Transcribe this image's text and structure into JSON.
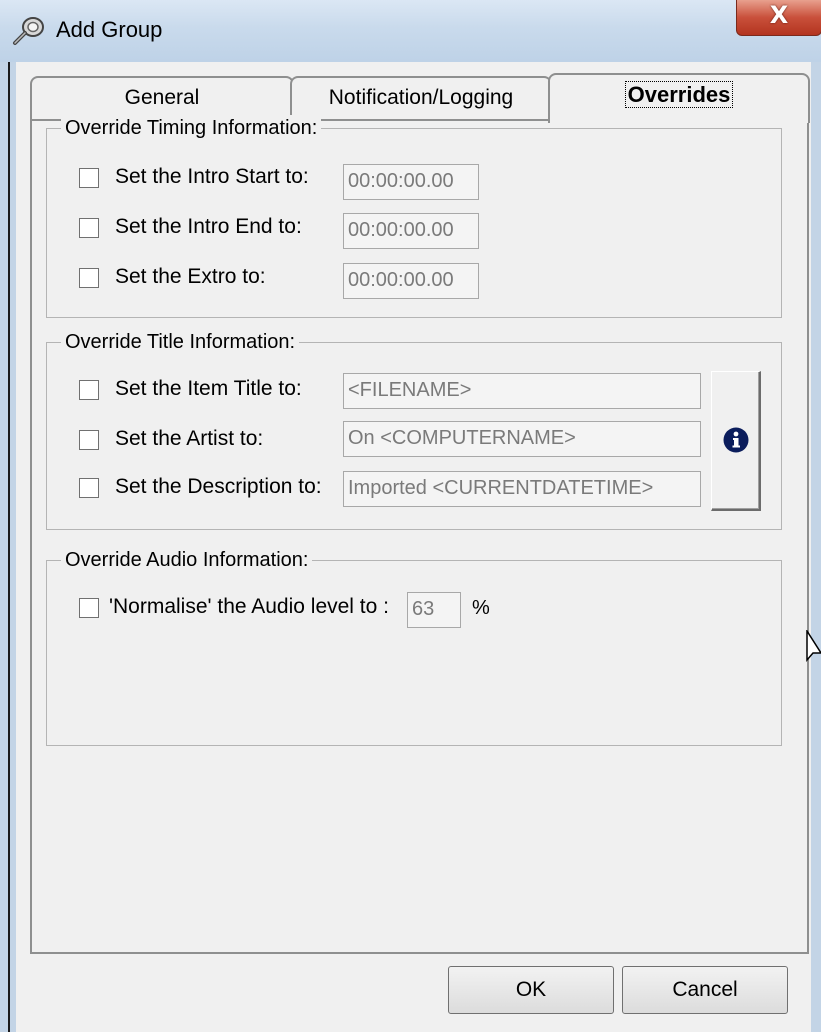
{
  "window": {
    "title": "Add Group",
    "close_label": "X"
  },
  "tabs": [
    {
      "label": "General",
      "selected": false
    },
    {
      "label": "Notification/Logging",
      "selected": false
    },
    {
      "label": "Overrides",
      "selected": true
    }
  ],
  "timing": {
    "title": "Override Timing Information:",
    "rows": [
      {
        "label": "Set the Intro Start to:",
        "value": "00:00:00.00",
        "checked": false
      },
      {
        "label": "Set the Intro End to:",
        "value": "00:00:00.00",
        "checked": false
      },
      {
        "label": "Set the Extro to:",
        "value": "00:00:00.00",
        "checked": false
      }
    ]
  },
  "title_info": {
    "title": "Override Title Information:",
    "rows": [
      {
        "label": "Set the Item Title to:",
        "value": "<FILENAME>",
        "checked": false
      },
      {
        "label": "Set the Artist to:",
        "value": "On <COMPUTERNAME>",
        "checked": false
      },
      {
        "label": "Set the Description to:",
        "value": "Imported <CURRENTDATETIME>",
        "checked": false
      }
    ],
    "info_button_icon": "info-icon"
  },
  "audio": {
    "title": "Override Audio Information:",
    "label": "'Normalise' the Audio level to :",
    "value": "63",
    "unit": "%",
    "checked": false
  },
  "buttons": {
    "ok": "OK",
    "cancel": "Cancel"
  },
  "colors": {
    "titlebar": "#c9daec",
    "close_button": "#c9503b",
    "info_icon": "#0b1d5c"
  }
}
